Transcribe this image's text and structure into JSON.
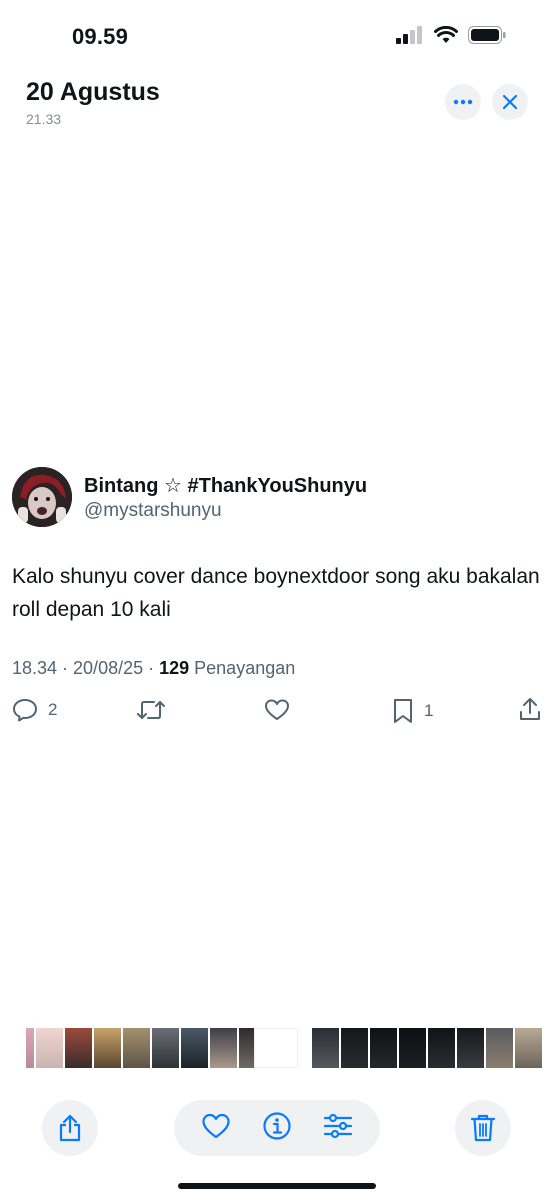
{
  "status_bar": {
    "time": "09.59"
  },
  "header": {
    "title": "20 Agustus",
    "subtitle": "21.33"
  },
  "tweet": {
    "display_name": "Bintang ☆ #ThankYouShunyu",
    "handle": "@mystarshunyu",
    "text": "Kalo shunyu cover dance boynextdoor song aku bakalan roll depan 10 kali",
    "timestamp": "18.34 · 20/08/25 · ",
    "views_count": "129",
    "views_label": " Penayangan",
    "reply_count": "2",
    "bookmark_count": "1"
  },
  "colors": {
    "accent": "#1d9bf0",
    "muted": "#536471",
    "ios_blue": "#0a7aff"
  },
  "icons": [
    "reply-icon",
    "retweet-icon",
    "like-icon",
    "bookmark-icon",
    "share-icon",
    "more-icon",
    "close-icon",
    "ios-share-icon",
    "heart-icon",
    "info-icon",
    "adjust-icon",
    "trash-icon"
  ]
}
